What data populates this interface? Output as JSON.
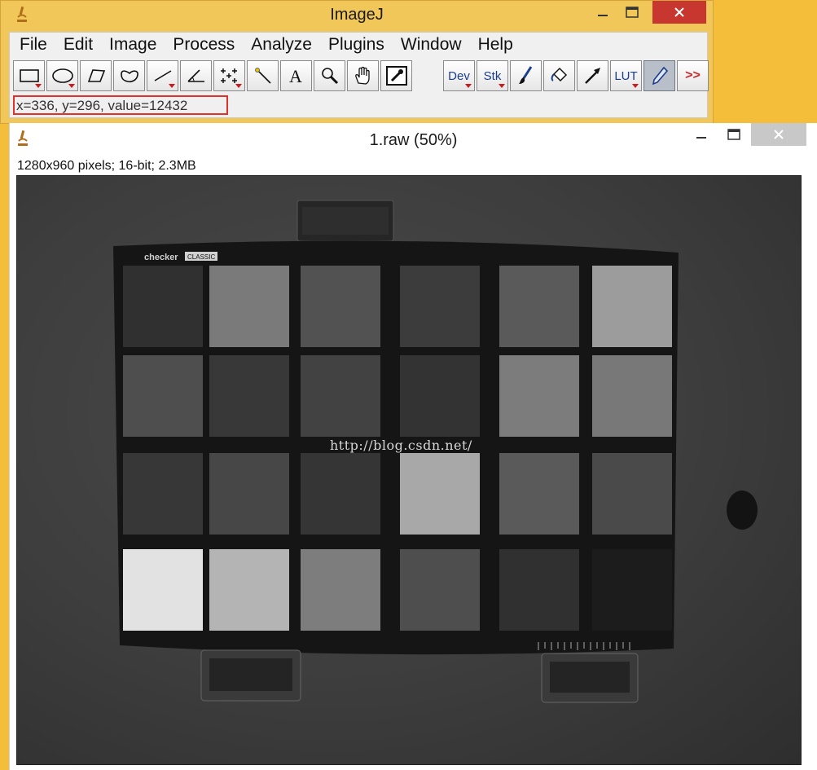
{
  "main_window": {
    "title": "ImageJ",
    "menu": [
      "File",
      "Edit",
      "Image",
      "Process",
      "Analyze",
      "Plugins",
      "Window",
      "Help"
    ],
    "tools": [
      {
        "name": "rectangle-tool",
        "icon": "rectangle-icon",
        "dropdown": true
      },
      {
        "name": "oval-tool",
        "icon": "oval-icon",
        "dropdown": true
      },
      {
        "name": "polygon-tool",
        "icon": "polygon-icon",
        "dropdown": false
      },
      {
        "name": "freehand-tool",
        "icon": "freehand-icon",
        "dropdown": false
      },
      {
        "name": "line-tool",
        "icon": "line-icon",
        "dropdown": true
      },
      {
        "name": "angle-tool",
        "icon": "angle-icon",
        "dropdown": false
      },
      {
        "name": "multipoint-tool",
        "icon": "multipoint-icon",
        "dropdown": true
      },
      {
        "name": "wand-tool",
        "icon": "wand-icon",
        "dropdown": false
      },
      {
        "name": "text-tool",
        "icon": "text-icon",
        "dropdown": false
      },
      {
        "name": "magnifier-tool",
        "icon": "magnifier-icon",
        "dropdown": false
      },
      {
        "name": "scroll-tool",
        "icon": "hand-icon",
        "dropdown": false
      },
      {
        "name": "color-picker-tool",
        "icon": "dropper-icon",
        "dropdown": false
      }
    ],
    "extra_tools": {
      "dev": "Dev",
      "stk": "Stk",
      "lut": "LUT",
      "more": ">>"
    },
    "status": "x=336, y=296, value=12432",
    "accent_color": "#f2c75a",
    "highlight_color": "#e0322d"
  },
  "image_window": {
    "title": "1.raw (50%)",
    "info": "1280x960 pixels; 16-bit; 2.3MB",
    "chart_label": "checker",
    "chart_badge": "CLASSIC",
    "watermark": "http://blog.csdn.net/",
    "patch_grays": [
      [
        "#303030",
        "#7a7a7a",
        "#525252",
        "#3c3c3c",
        "#5a5a5a",
        "#9c9c9c"
      ],
      [
        "#4e4e4e",
        "#383838",
        "#424242",
        "#333333",
        "#7c7c7c",
        "#787878"
      ],
      [
        "#373737",
        "#474747",
        "#353535",
        "#a8a8a8",
        "#5a5a5a",
        "#4a4a4a"
      ],
      [
        "#e2e2e2",
        "#b4b4b4",
        "#7d7d7d",
        "#4e4e4e",
        "#303030",
        "#1c1c1c"
      ]
    ]
  }
}
